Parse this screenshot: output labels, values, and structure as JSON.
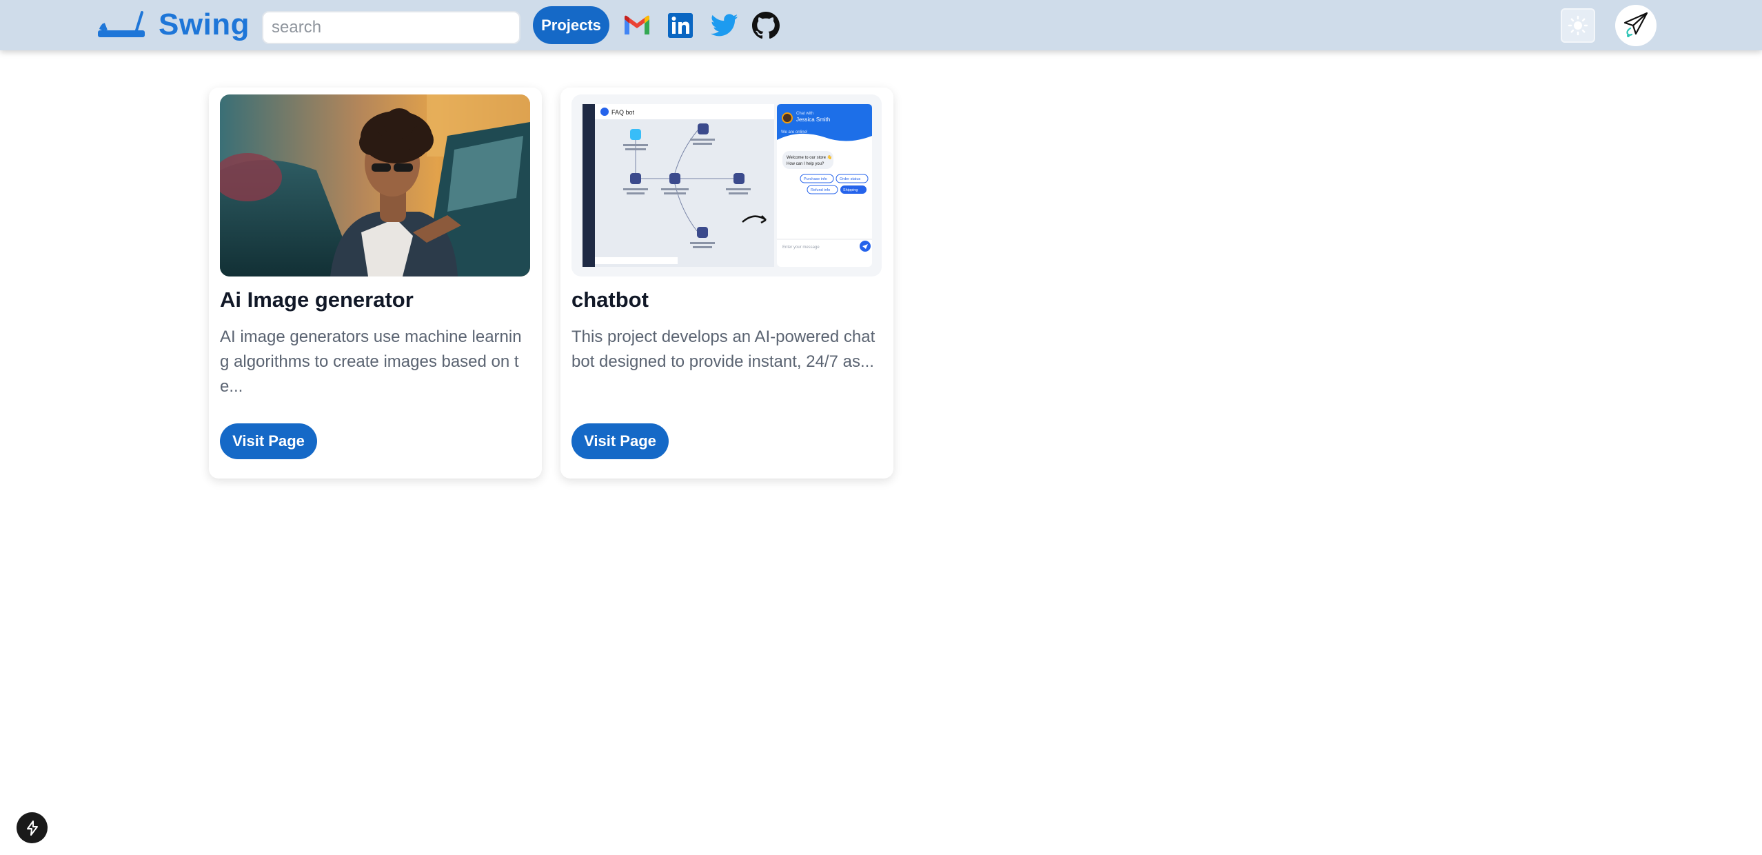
{
  "header": {
    "brand": "Swing",
    "search_placeholder": "search",
    "projects_label": "Projects",
    "social_icons": [
      "gmail-icon",
      "linkedin-icon",
      "twitter-icon",
      "github-icon"
    ]
  },
  "colors": {
    "header_bg": "#cfdcea",
    "accent": "#1569c7",
    "brand": "#1e76d8"
  },
  "cards": [
    {
      "title": "Ai Image generator",
      "description": "AI image generators use machine learning algorithms to create images based on te...",
      "button_label": "Visit Page"
    },
    {
      "title": "chatbot",
      "description": "This project develops an AI-powered chatbot designed to provide instant, 24/7 as...",
      "button_label": "Visit Page"
    }
  ],
  "chatbot_preview": {
    "bot_name": "FAQ bot",
    "chat_with": "Chat with",
    "agent_name": "Jessica Smith",
    "status": "We are online!",
    "greeting": "Welcome to our store 👋",
    "greeting_sub": "How can I help you?",
    "options": [
      "Purchase info",
      "Order status",
      "Refund info",
      "Shipping"
    ],
    "input_placeholder": "Enter your message"
  }
}
